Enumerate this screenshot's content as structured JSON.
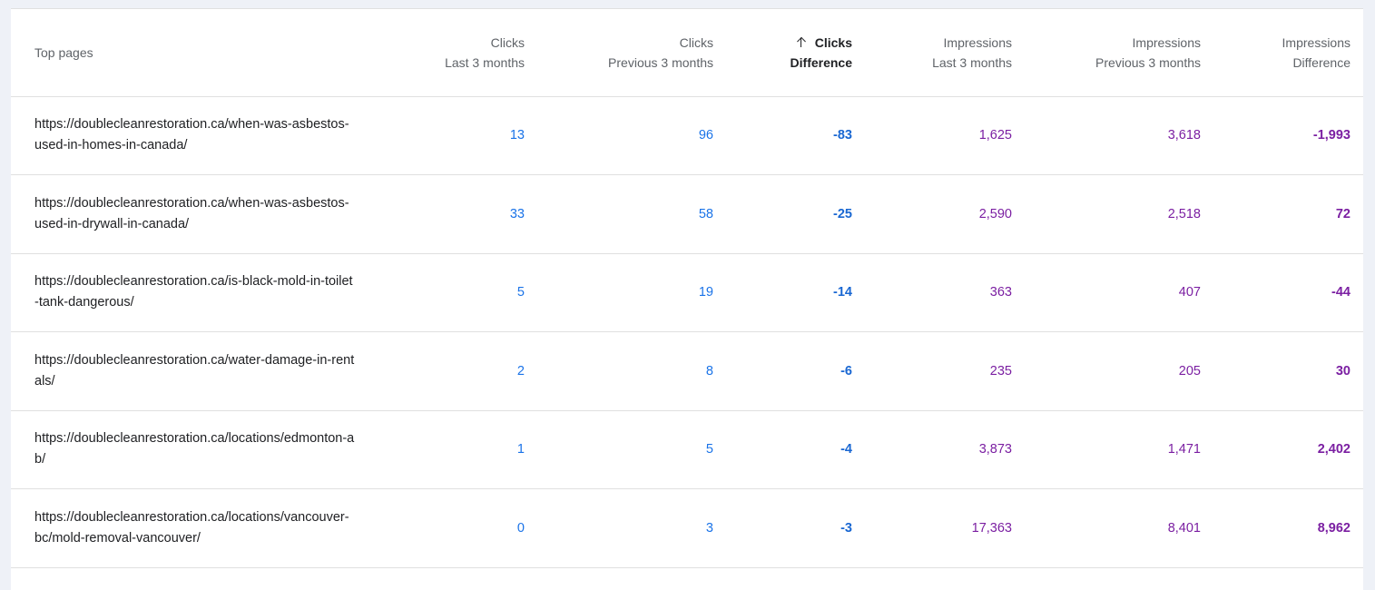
{
  "header": {
    "top_pages": "Top pages",
    "clicks_last_1": "Clicks",
    "clicks_last_2": "Last 3 months",
    "clicks_prev_1": "Clicks",
    "clicks_prev_2": "Previous 3 months",
    "clicks_diff_1": "Clicks",
    "clicks_diff_2": "Difference",
    "impr_last_1": "Impressions",
    "impr_last_2": "Last 3 months",
    "impr_prev_1": "Impressions",
    "impr_prev_2": "Previous 3 months",
    "impr_diff_1": "Impressions",
    "impr_diff_2": "Difference",
    "sort_icon": "arrow-up-icon"
  },
  "rows": [
    {
      "url": "https://doublecleanrestoration.ca/when-was-asbestos-used-in-homes-in-canada/",
      "clicks_last": "13",
      "clicks_prev": "96",
      "clicks_diff": "-83",
      "impr_last": "1,625",
      "impr_prev": "3,618",
      "impr_diff": "-1,993"
    },
    {
      "url": "https://doublecleanrestoration.ca/when-was-asbestos-used-in-drywall-in-canada/",
      "clicks_last": "33",
      "clicks_prev": "58",
      "clicks_diff": "-25",
      "impr_last": "2,590",
      "impr_prev": "2,518",
      "impr_diff": "72"
    },
    {
      "url": "https://doublecleanrestoration.ca/is-black-mold-in-toilet-tank-dangerous/",
      "clicks_last": "5",
      "clicks_prev": "19",
      "clicks_diff": "-14",
      "impr_last": "363",
      "impr_prev": "407",
      "impr_diff": "-44"
    },
    {
      "url": "https://doublecleanrestoration.ca/water-damage-in-rentals/",
      "clicks_last": "2",
      "clicks_prev": "8",
      "clicks_diff": "-6",
      "impr_last": "235",
      "impr_prev": "205",
      "impr_diff": "30"
    },
    {
      "url": "https://doublecleanrestoration.ca/locations/edmonton-ab/",
      "clicks_last": "1",
      "clicks_prev": "5",
      "clicks_diff": "-4",
      "impr_last": "3,873",
      "impr_prev": "1,471",
      "impr_diff": "2,402"
    },
    {
      "url": "https://doublecleanrestoration.ca/locations/vancouver-bc/mold-removal-vancouver/",
      "clicks_last": "0",
      "clicks_prev": "3",
      "clicks_diff": "-3",
      "impr_last": "17,363",
      "impr_prev": "8,401",
      "impr_diff": "8,962"
    }
  ],
  "colors": {
    "clicks": "#1a73e8",
    "impressions": "#7b1fa2",
    "page_bg": "#eef1f7"
  }
}
